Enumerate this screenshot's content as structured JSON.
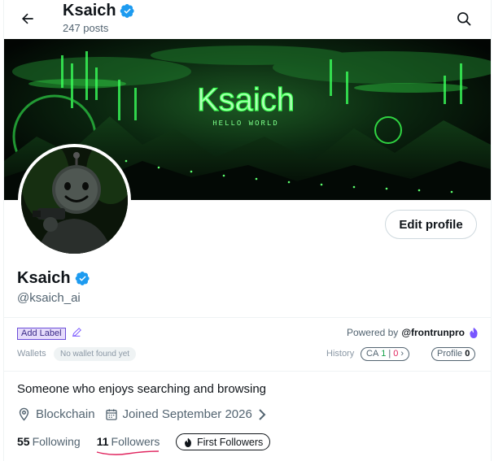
{
  "header": {
    "name": "Ksaich",
    "posts": "247 posts"
  },
  "banner": {
    "title": "Ksaich",
    "subtitle": "HELLO WORLD"
  },
  "profile": {
    "name": "Ksaich",
    "handle": "@ksaich_ai",
    "edit_label": "Edit profile"
  },
  "plugin": {
    "add_label": "Add Label",
    "powered_by": "Powered by",
    "powered_handle": "@frontrunpro",
    "wallets_label": "Wallets",
    "no_wallet": "No wallet found yet",
    "history_label": "History",
    "ca_label": "CA",
    "ca_green": "1",
    "ca_red": "0",
    "profile_label": "Profile",
    "profile_count": "0"
  },
  "bio": "Someone who enjoys searching and browsing",
  "meta": {
    "location": "Blockchain",
    "joined": "Joined September 2026"
  },
  "stats": {
    "following_count": "55",
    "following_label": "Following",
    "followers_count": "11",
    "followers_label": "Followers",
    "first_followers": "First Followers"
  },
  "colors": {
    "verified": "#1d9bf0",
    "accent_purple": "#7856ff",
    "neon_green": "#39ff4f"
  }
}
